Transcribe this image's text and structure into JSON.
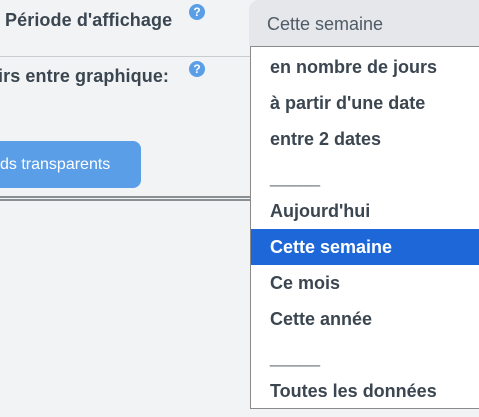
{
  "settings": {
    "period_label": "Période d'affichage",
    "colors_label": "irs entre graphique:",
    "help_glyph": "?",
    "transparent_button_label": "ds transparents"
  },
  "select": {
    "current_value": "Cette semaine"
  },
  "dropdown": {
    "options": [
      "en nombre de jours",
      "à partir d'une date",
      "entre 2 dates",
      "_____",
      "Aujourd'hui",
      "Cette semaine",
      "Ce mois",
      "Cette année",
      "_____",
      "Toutes les données"
    ],
    "selected_index": 5
  },
  "colors": {
    "accent": "#5b9ee8",
    "selected_option": "#1e67d9",
    "background": "#f1f3f5"
  },
  "icons": {
    "help": "question-circle-icon"
  }
}
